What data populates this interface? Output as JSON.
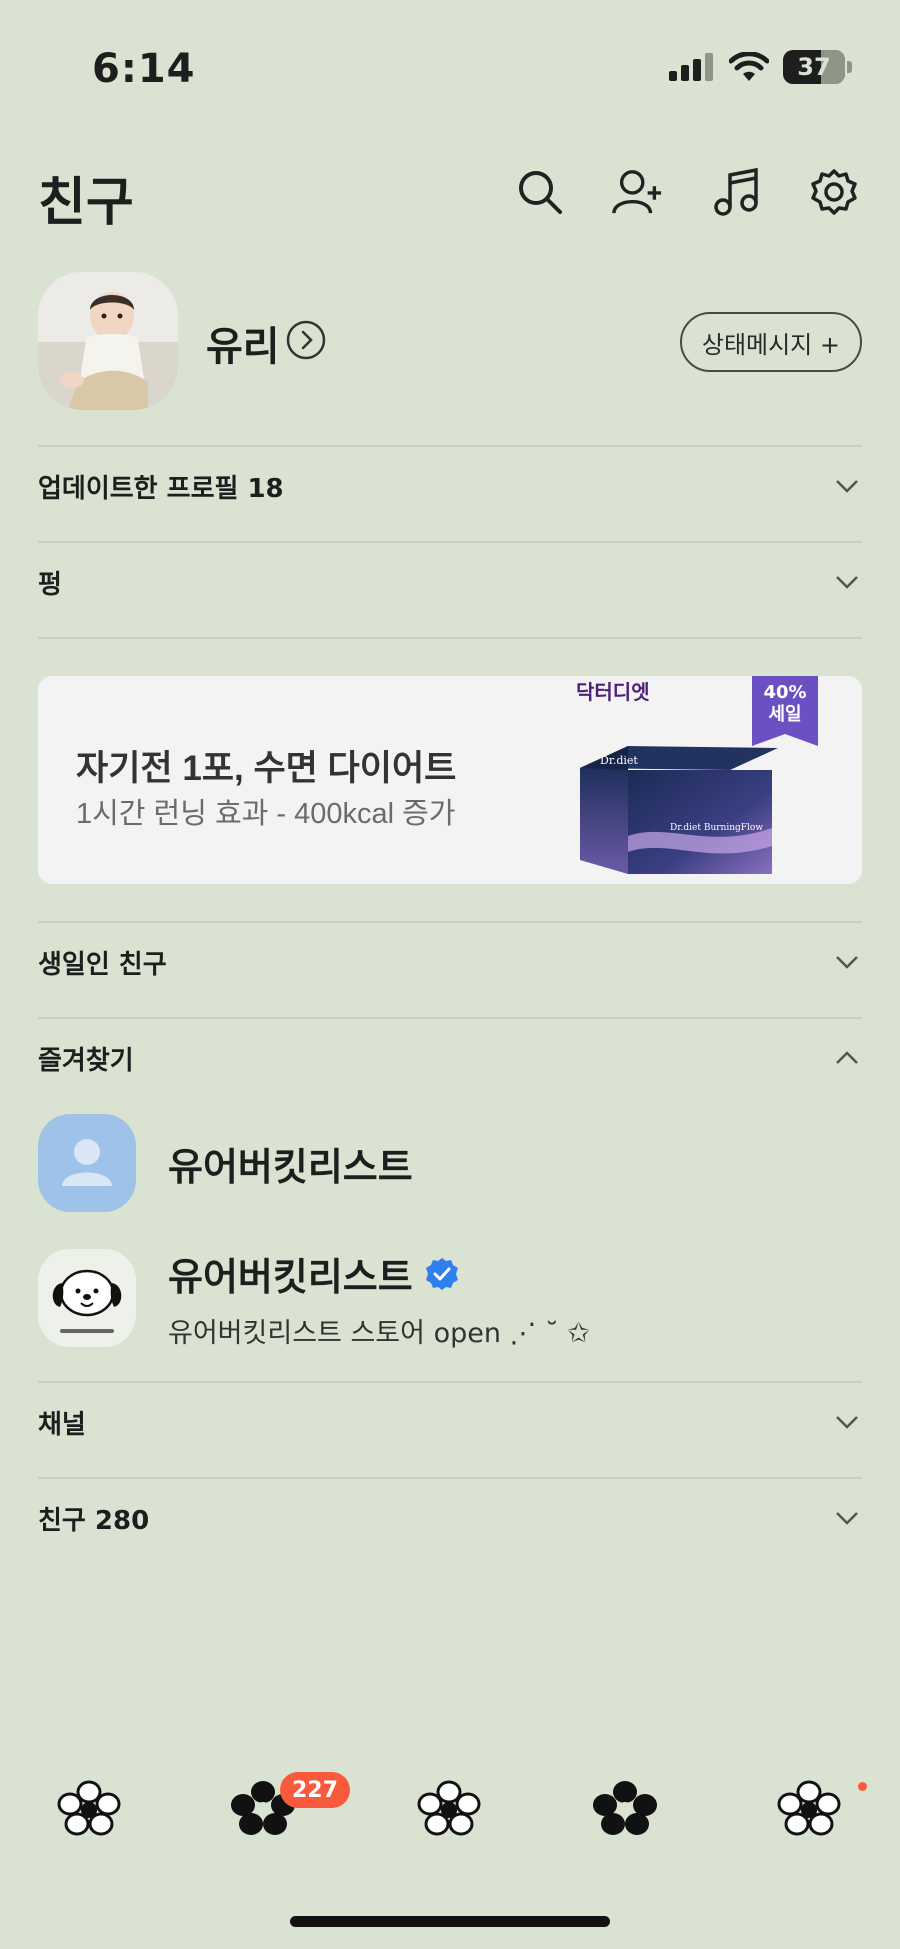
{
  "status_bar": {
    "time": "6:14",
    "battery": "37"
  },
  "header": {
    "title": "친구"
  },
  "profile": {
    "name": "유리",
    "status_button_label": "상태메시지 +"
  },
  "sections": {
    "updated_profiles": "업데이트한 프로필 18",
    "pung": "펑",
    "birthday_friends": "생일인 친구",
    "favorites": "즐겨찾기",
    "channels": "채널",
    "friends": "친구 280"
  },
  "ad": {
    "title": "자기전 1포, 수면 다이어트",
    "subtitle": "1시간 런닝 효과 - 400kcal 증가",
    "brand": "닥터디엣",
    "sale_line1": "40%",
    "sale_line2": "세일",
    "box_brand": "Dr.diet",
    "box_product": "Dr.diet BurningFlow"
  },
  "favorites": [
    {
      "name": "유어버킷리스트",
      "status": ""
    },
    {
      "name": "유어버킷리스트",
      "status": "유어버킷리스트 스토어 open ⋰ ˘ ✩"
    }
  ],
  "tabbar": {
    "chat_badge": "227"
  },
  "colors": {
    "background": "#dae3d2",
    "badge": "#fa5a3c",
    "verified": "#2f80ed",
    "sale": "#6b50c4"
  }
}
